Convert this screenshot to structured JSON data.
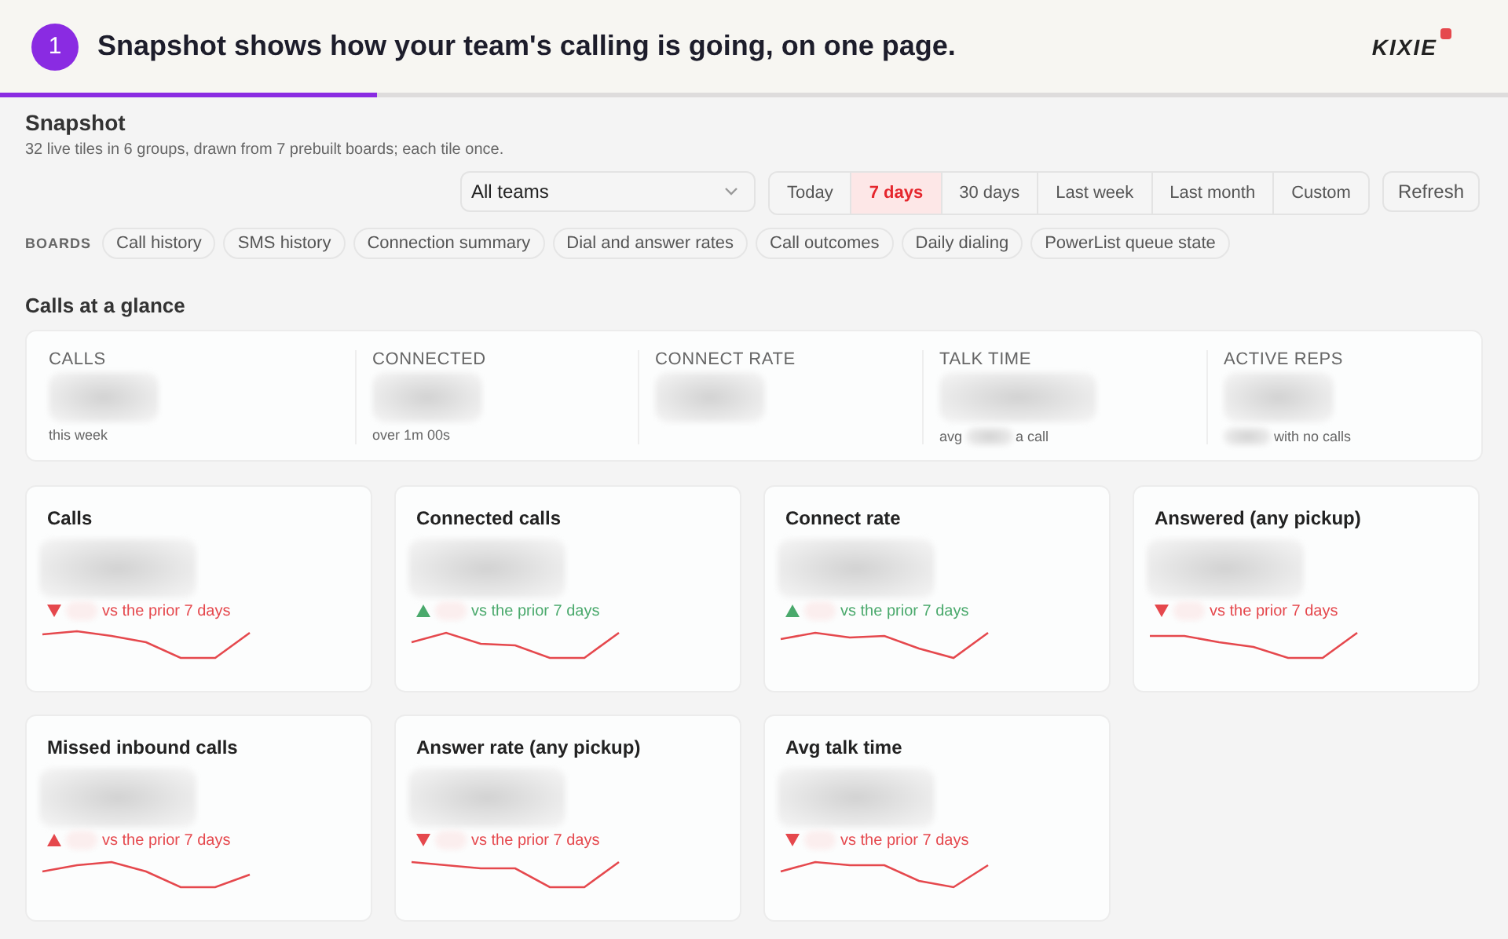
{
  "banner": {
    "step": "1",
    "headline": "Snapshot shows how your team's calling is going, on one page.",
    "brand": "KIXIE",
    "progress": {
      "level": 0.25
    }
  },
  "page": {
    "title": "Snapshot",
    "subtitle": "32 live tiles in 6 groups, drawn from 7 prebuilt boards; each tile once."
  },
  "filters": {
    "team_select": "All teams",
    "ranges": [
      {
        "label": "Today",
        "selected": false
      },
      {
        "label": "7 days",
        "selected": true
      },
      {
        "label": "30 days",
        "selected": false
      },
      {
        "label": "Last week",
        "selected": false
      },
      {
        "label": "Last month",
        "selected": false
      },
      {
        "label": "Custom",
        "selected": false
      }
    ],
    "refresh": "Refresh"
  },
  "boards": {
    "label": "BOARDS",
    "items": [
      "Call history",
      "SMS history",
      "Connection summary",
      "Dial and answer rates",
      "Call outcomes",
      "Daily dialing",
      "PowerList queue state"
    ]
  },
  "glance": {
    "title": "Calls at a glance",
    "stats": [
      {
        "label": "CALLS",
        "note": [
          {
            "kind": "text",
            "text": "this week"
          }
        ]
      },
      {
        "label": "CONNECTED",
        "note": [
          {
            "kind": "text",
            "text": "over 1m 00s"
          }
        ]
      },
      {
        "label": "CONNECT RATE"
      },
      {
        "label": "TALK TIME",
        "note": [
          {
            "kind": "text",
            "text": "avg"
          },
          {
            "kind": "blur"
          },
          {
            "kind": "text",
            "text": "a call"
          }
        ]
      },
      {
        "label": "ACTIVE REPS",
        "note": [
          {
            "kind": "blur"
          },
          {
            "kind": "text",
            "text": "with no calls"
          }
        ]
      }
    ]
  },
  "tiles": [
    {
      "title": "Calls",
      "rising": false,
      "favorable": false,
      "comparison": "vs the prior 7 days"
    },
    {
      "title": "Connected calls",
      "rising": true,
      "favorable": true,
      "comparison": "vs the prior 7 days"
    },
    {
      "title": "Connect rate",
      "rising": true,
      "favorable": true,
      "comparison": "vs the prior 7 days"
    },
    {
      "title": "Answered (any pickup)",
      "rising": false,
      "favorable": false,
      "comparison": "vs the prior 7 days"
    },
    {
      "title": "Missed inbound calls",
      "rising": true,
      "favorable": false,
      "comparison": "vs the prior 7 days"
    },
    {
      "title": "Answer rate (any pickup)",
      "rising": false,
      "favorable": false,
      "comparison": "vs the prior 7 days"
    },
    {
      "title": "Avg talk time",
      "rising": false,
      "favorable": false,
      "comparison": "vs the prior 7 days"
    }
  ]
}
